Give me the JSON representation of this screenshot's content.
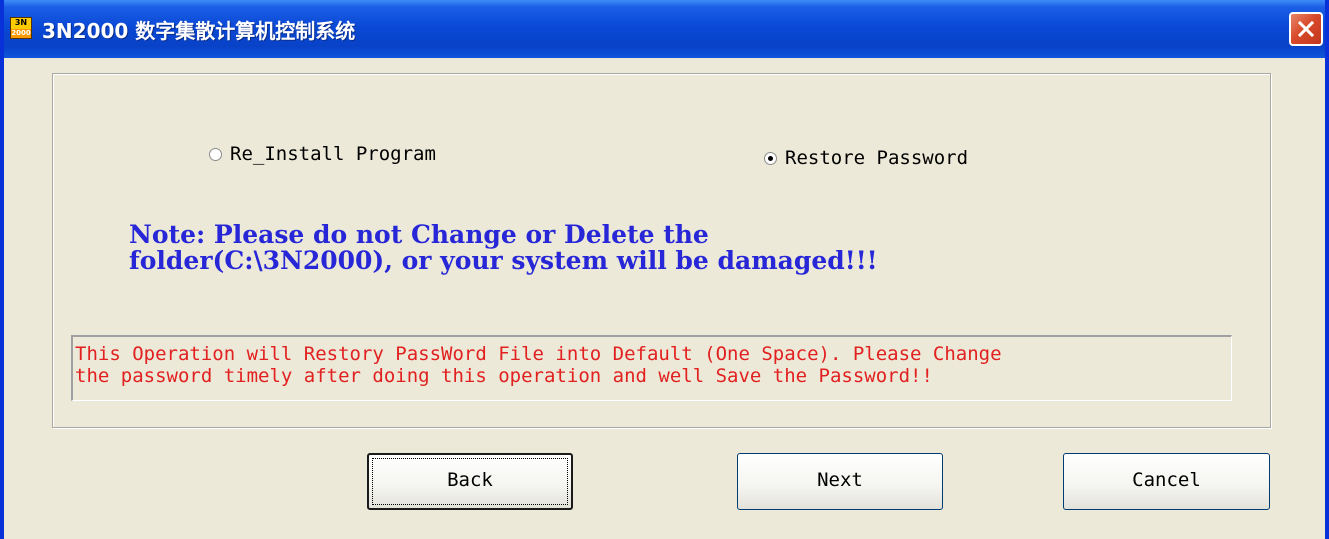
{
  "window": {
    "title": "3N2000 数字集散计算机控制系统",
    "icon": {
      "name": "app-logo-icon",
      "top_text": "3N",
      "bottom_text": "2000"
    },
    "close_icon": "close-icon",
    "colors": {
      "titlebar": "#0a49d6",
      "close": "#d94a2b",
      "face": "#ece9d8"
    }
  },
  "options": {
    "reinstall": {
      "label": "Re_Install Program",
      "selected": false
    },
    "restore": {
      "label": "Restore Password",
      "selected": true
    }
  },
  "note": {
    "line1": "Note: Please do not Change or Delete the",
    "line2": "folder(C:\\3N2000), or your system will be damaged!!!",
    "color": "#2727d8"
  },
  "message": {
    "line1": "This Operation will Restory PassWord File into Default (One Space). Please Change",
    "line2": "the password timely after doing this operation and well Save the Password!!",
    "color": "#e22020"
  },
  "buttons": {
    "back": "Back",
    "next": "Next",
    "cancel": "Cancel"
  }
}
